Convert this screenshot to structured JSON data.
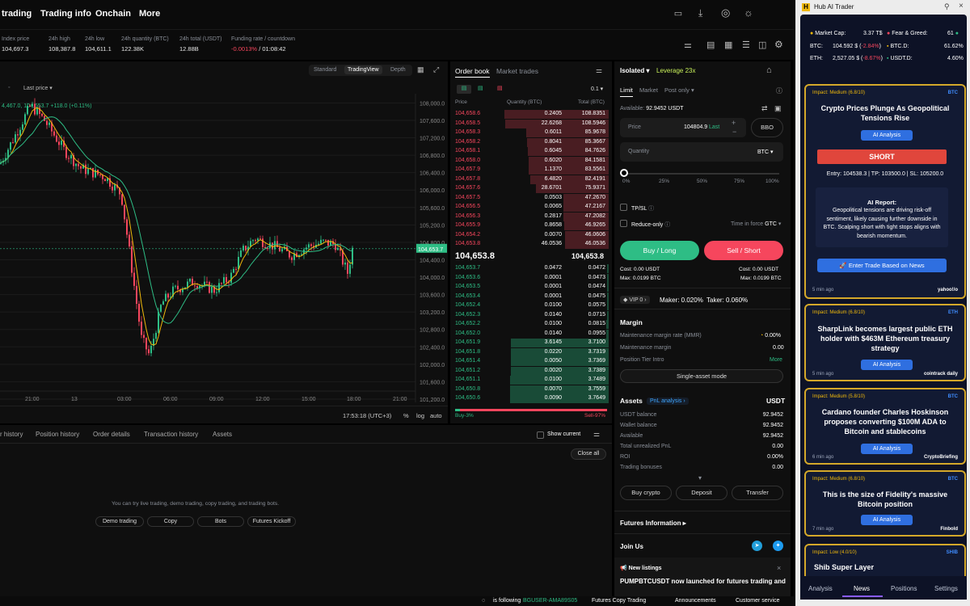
{
  "nav": {
    "items": [
      "trading",
      "Trading info",
      "Onchain",
      "More"
    ]
  },
  "stats": [
    {
      "label": "Index price",
      "value": "104,697.3"
    },
    {
      "label": "24h high",
      "value": "108,387.8"
    },
    {
      "label": "24h low",
      "value": "104,611.1"
    },
    {
      "label": "24h quantity (BTC)",
      "value": "122.38K"
    },
    {
      "label": "24h total (USDT)",
      "value": "12.88B"
    },
    {
      "label": "Funding rate / countdown",
      "value_neg": "-0.0013%",
      "value": "/ 01:08:42"
    }
  ],
  "chart": {
    "views": [
      "Standard",
      "TradingView",
      "Depth"
    ],
    "price_label": "Last price",
    "ohlc_text": "4,467.0",
    "ohlc_value": "104,653.7",
    "ohlc_change": "+118.0 (+0.11%)",
    "yticks": [
      "108,000.0",
      "107,600.0",
      "107,200.0",
      "106,800.0",
      "106,400.0",
      "106,000.0",
      "105,600.0",
      "105,200.0",
      "104,800.0",
      "104,400.0",
      "104,000.0",
      "103,600.0",
      "103,200.0",
      "102,800.0",
      "102,400.0",
      "102,000.0",
      "101,600.0",
      "101,200.0"
    ],
    "last_tag": "104,653.7",
    "xticks": [
      "21:00",
      "13",
      "03:00",
      "06:00",
      "09:00",
      "12:00",
      "15:00",
      "18:00",
      "21:00"
    ],
    "time": "17:53:18 (UTC+3)",
    "pct": "%",
    "log": "log",
    "auto": "auto"
  },
  "orderbook": {
    "tabs": [
      "Order book",
      "Market trades"
    ],
    "step": "0.1",
    "headers": [
      "Price",
      "Quantity (BTC)",
      "Total (BTC)"
    ],
    "asks": [
      [
        "104,658.6",
        "0.2405",
        "108.8351"
      ],
      [
        "104,658.5",
        "22.6268",
        "108.5946"
      ],
      [
        "104,658.3",
        "0.6011",
        "85.9678"
      ],
      [
        "104,658.2",
        "0.8041",
        "85.3667"
      ],
      [
        "104,658.1",
        "0.6045",
        "84.7626"
      ],
      [
        "104,658.0",
        "0.6020",
        "84.1581"
      ],
      [
        "104,657.9",
        "1.1370",
        "83.5561"
      ],
      [
        "104,657.8",
        "6.4820",
        "82.4191"
      ],
      [
        "104,657.6",
        "28.6701",
        "75.9371"
      ],
      [
        "104,657.5",
        "0.0503",
        "47.2670"
      ],
      [
        "104,656.5",
        "0.0065",
        "47.2167"
      ],
      [
        "104,656.3",
        "0.2817",
        "47.2082"
      ],
      [
        "104,655.9",
        "0.8658",
        "46.9265"
      ],
      [
        "104,654.2",
        "0.0070",
        "46.0606"
      ],
      [
        "104,653.8",
        "46.0536",
        "46.0536"
      ]
    ],
    "mid": "104,653.8",
    "mid2": "104,653.8",
    "bids": [
      [
        "104,653.7",
        "0.0472",
        "0.0472"
      ],
      [
        "104,653.6",
        "0.0001",
        "0.0473"
      ],
      [
        "104,653.5",
        "0.0001",
        "0.0474"
      ],
      [
        "104,653.4",
        "0.0001",
        "0.0475"
      ],
      [
        "104,652.4",
        "0.0100",
        "0.0575"
      ],
      [
        "104,652.3",
        "0.0140",
        "0.0715"
      ],
      [
        "104,652.2",
        "0.0100",
        "0.0815"
      ],
      [
        "104,652.0",
        "0.0140",
        "0.0955"
      ],
      [
        "104,651.9",
        "3.6145",
        "3.7100"
      ],
      [
        "104,651.8",
        "0.0220",
        "3.7319"
      ],
      [
        "104,651.4",
        "0.0050",
        "3.7369"
      ],
      [
        "104,651.2",
        "0.0020",
        "3.7389"
      ],
      [
        "104,651.1",
        "0.0100",
        "3.7489"
      ],
      [
        "104,650.8",
        "0.0070",
        "3.7559"
      ],
      [
        "104,650.6",
        "0.0090",
        "3.7649"
      ]
    ],
    "buy_pct": "Buy-3%",
    "sell_pct": "Sell-97%",
    "buy_fraction": 0.03
  },
  "trade": {
    "margin_mode": "Isolated",
    "leverage": "Leverage 23x",
    "order_tabs": [
      "Limit",
      "Market",
      "Post only"
    ],
    "available_label": "Available:",
    "available": "92.9452 USDT",
    "price_label": "Price",
    "price_value": "104804.9",
    "price_last": "Last",
    "bbo": "BBO",
    "qty_label": "Quantity",
    "qty_unit": "BTC",
    "slider": [
      "0%",
      "25%",
      "50%",
      "75%",
      "100%"
    ],
    "tpsl": "TP/SL",
    "reduce": "Reduce-only",
    "tif_label": "Time in force",
    "tif": "GTC",
    "buy": "Buy / Long",
    "sell": "Sell / Short",
    "cost_l": "Cost: 0.00 USDT",
    "cost_r": "Cost: 0.00 USDT",
    "max_l": "Max: 0.0199 BTC",
    "max_r": "Max: 0.0199 BTC",
    "vip": "VIP 0",
    "maker": "Maker: 0.020%",
    "taker": "Taker: 0.060%",
    "margin_title": "Margin",
    "mmr_label": "Maintenance margin rate (MMR)",
    "mmr": "0.00%",
    "mm_label": "Maintenance margin",
    "mm": "0.00",
    "tier_label": "Position Tier Intro",
    "tier_more": "More",
    "single_asset": "Single-asset mode",
    "assets_title": "Assets",
    "pnl": "PnL analysis",
    "assets_unit": "USDT",
    "assets": [
      [
        "USDT balance",
        "92.9452"
      ],
      [
        "Wallet balance",
        "92.9452"
      ],
      [
        "Available",
        "92.9452"
      ],
      [
        "Total unrealized PnL",
        "0.00"
      ],
      [
        "ROI",
        "0.00%"
      ],
      [
        "Trading bonuses",
        "0.00"
      ]
    ],
    "buttons": [
      "Buy crypto",
      "Deposit",
      "Transfer"
    ],
    "futures_info": "Futures Information",
    "join_us": "Join Us",
    "new_listings": "New listings",
    "listing_text": "PUMPBTCUSDT now launched for futures trading and"
  },
  "bottom": {
    "tabs": [
      "r history",
      "Position history",
      "Order details",
      "Transaction history",
      "Assets"
    ],
    "show_current": "Show current",
    "close_all": "Close all",
    "empty_text": "You can try live trading, demo trading, copy trading, and trading bots.",
    "buttons": [
      "Demo trading",
      "Copy",
      "Bots",
      "Futures Kickoff"
    ]
  },
  "footer": {
    "following": "is following",
    "user": "BGUSER-AMA89S05",
    "links": [
      "Futures Copy Trading",
      "Announcements",
      "Customer service"
    ]
  },
  "hub": {
    "title": "Hub AI Trader",
    "market_cap_label": "Market Cap:",
    "market_cap": "3.37 T$",
    "fear_label": "Fear & Greed:",
    "fear": "61",
    "btc_label": "BTC:",
    "btc_price": "104.592 $",
    "btc_change": "-2.84%",
    "btcd_label": "BTC.D:",
    "btcd": "61.62%",
    "eth_label": "ETH:",
    "eth_price": "2,527.05 $",
    "eth_change": "-8.67%",
    "usdtd_label": "USDT.D:",
    "usdtd": "4.60%",
    "cards": [
      {
        "impact": "Impact: Medium (6.8/10)",
        "tag": "BTC",
        "title": "Crypto Prices Plunge As Geopolitical Tensions Rise",
        "ai": "AI Analysis",
        "signal": "SHORT",
        "entry": "Entry: 104538.3 | TP: 103500.0 | SL: 105200.0",
        "report_title": "AI Report:",
        "report": "Geopolitical tensions are driving risk-off sentiment, likely causing further downside in BTC. Scalping short with tight stops aligns with bearish momentum.",
        "enter": "Enter Trade Based on News",
        "ago": "5 min ago",
        "source": "yahoo!/o"
      },
      {
        "impact": "Impact: Medium (6.8/10)",
        "tag": "ETH",
        "title": "SharpLink becomes largest public ETH holder with $463M Ethereum treasury strategy",
        "ai": "AI Analysis",
        "ago": "5 min ago",
        "source": "cointrack daily"
      },
      {
        "impact": "Impact: Medium (5.8/10)",
        "tag": "BTC",
        "title": "Cardano founder Charles Hoskinson proposes converting $100M ADA to Bitcoin and stablecoins",
        "ai": "AI Analysis",
        "ago": "6 min ago",
        "source": "CryptoBriefing"
      },
      {
        "impact": "Impact: Medium (6.8/10)",
        "tag": "BTC",
        "title": "This is the size of Fidelity's massive Bitcoin position",
        "ai": "AI Analysis",
        "ago": "7 min ago",
        "source": "Finbold"
      },
      {
        "impact": "Impact: Low (4.0/10)",
        "tag": "SHIB",
        "title": "Shib Super Layer"
      }
    ],
    "tabs": [
      "Analysis",
      "News",
      "Positions",
      "Settings"
    ]
  },
  "colors": {
    "up": "#2ebd85",
    "down": "#f6465d",
    "accent": "#c8f05a",
    "hub_border": "#d4a82a",
    "hub_blue": "#2f6fe0"
  }
}
